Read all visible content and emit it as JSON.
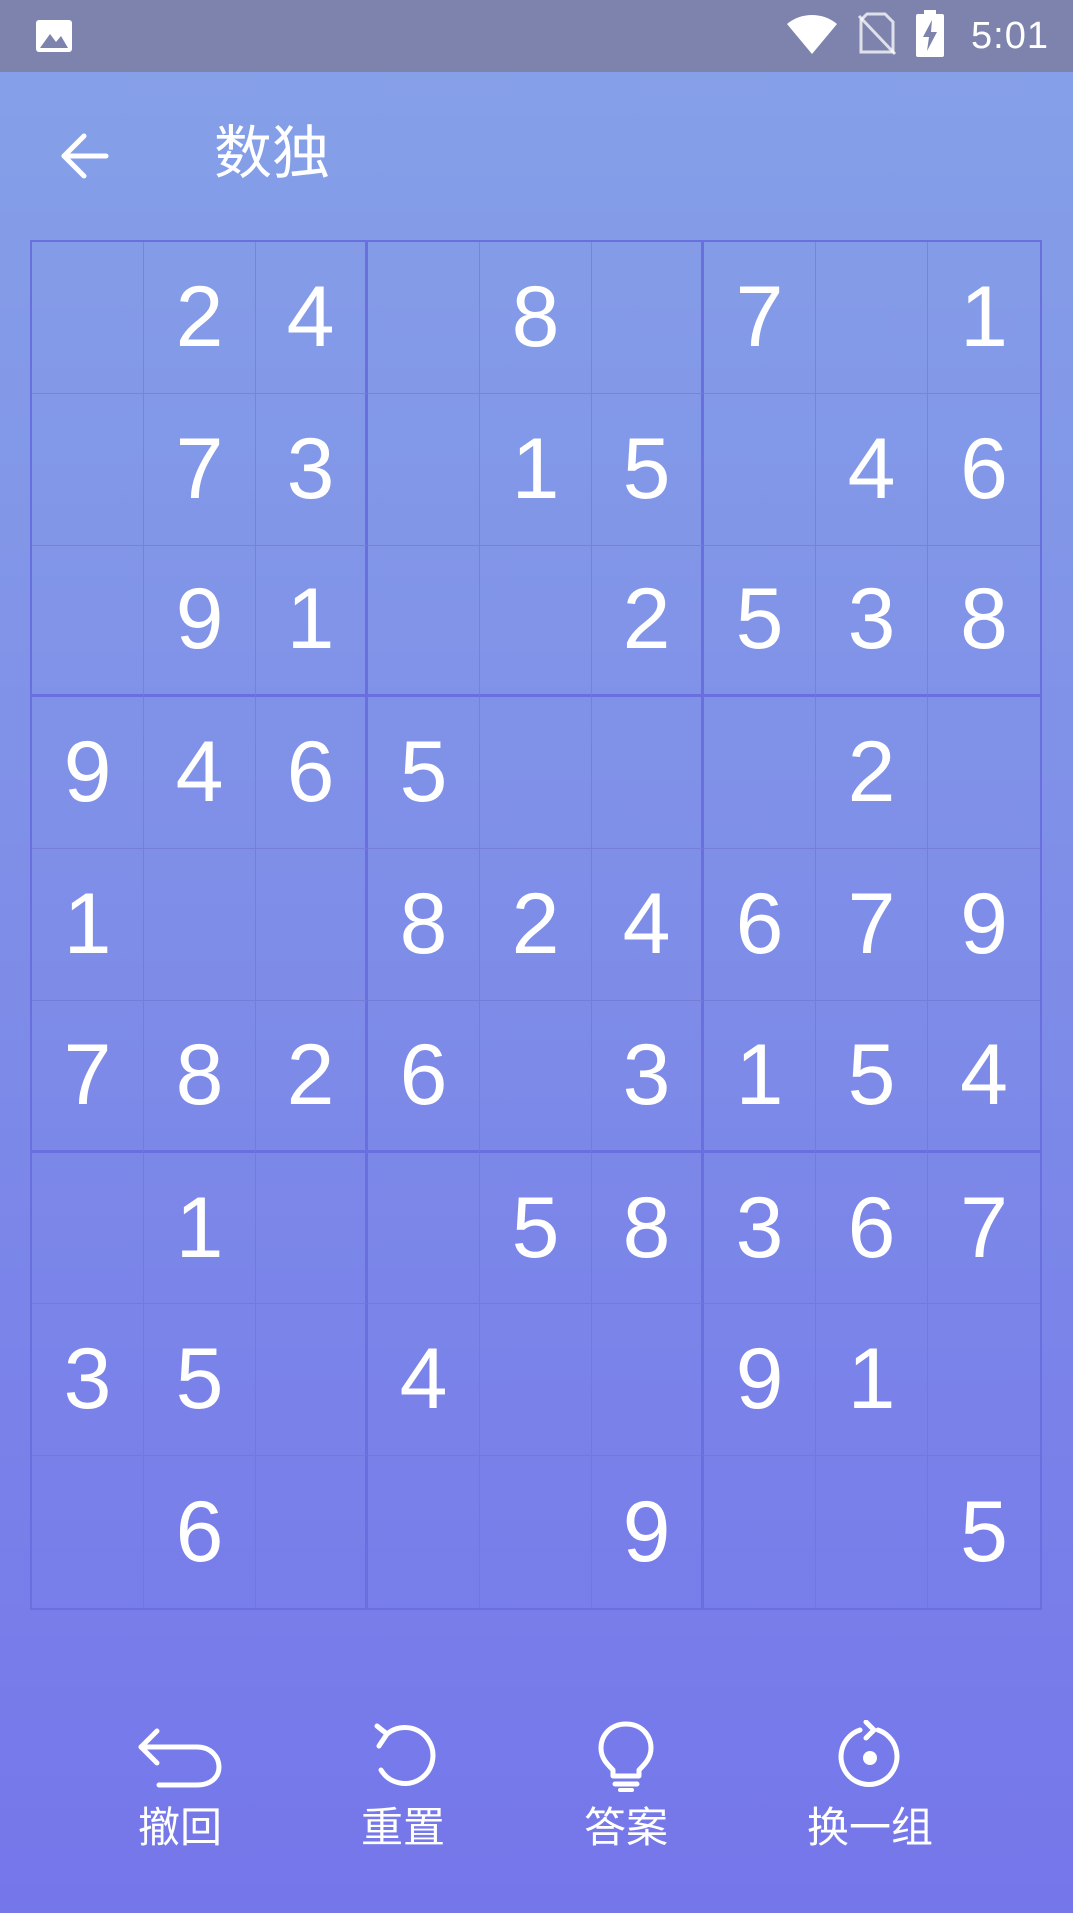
{
  "status_bar": {
    "time": "5:01",
    "icons": [
      "image-icon",
      "wifi-icon",
      "no-sim-icon",
      "battery-charging-icon"
    ]
  },
  "app_bar": {
    "title": "数独",
    "back_icon": "arrow-left-icon"
  },
  "board": {
    "rows": [
      [
        "",
        "2",
        "4",
        "",
        "8",
        "",
        "7",
        "",
        "1"
      ],
      [
        "",
        "7",
        "3",
        "",
        "1",
        "5",
        "",
        "4",
        "6"
      ],
      [
        "",
        "9",
        "1",
        "",
        "",
        "2",
        "5",
        "3",
        "8"
      ],
      [
        "9",
        "4",
        "6",
        "5",
        "",
        "",
        "",
        "2",
        ""
      ],
      [
        "1",
        "",
        "",
        "8",
        "2",
        "4",
        "6",
        "7",
        "9"
      ],
      [
        "7",
        "8",
        "2",
        "6",
        "",
        "3",
        "1",
        "5",
        "4"
      ],
      [
        "",
        "1",
        "",
        "",
        "5",
        "8",
        "3",
        "6",
        "7"
      ],
      [
        "3",
        "5",
        "",
        "4",
        "",
        "",
        "9",
        "1",
        ""
      ],
      [
        "",
        "6",
        "",
        "",
        "",
        "9",
        "",
        "",
        "5"
      ]
    ]
  },
  "toolbar": {
    "undo_label": "撤回",
    "reset_label": "重置",
    "answer_label": "答案",
    "new_label": "换一组"
  },
  "colors": {
    "status_bar": "#7d83ac",
    "background_top": "#86a1e8",
    "background_bottom": "#7576ea",
    "grid_line": "#6a6fe0",
    "text": "#ffffff"
  }
}
